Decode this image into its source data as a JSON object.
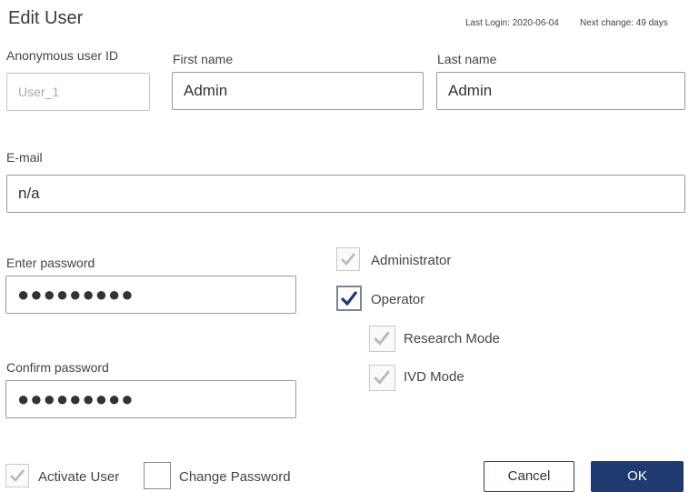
{
  "dialog": {
    "title": "Edit User",
    "last_login": "Last Login: 2020-06-04",
    "next_change": "Next change: 49 days"
  },
  "fields": {
    "anonymous_id": {
      "label": "Anonymous user ID",
      "placeholder": "User_1"
    },
    "first_name": {
      "label": "First name",
      "value": "Admin"
    },
    "last_name": {
      "label": "Last name",
      "value": "Admin"
    },
    "email": {
      "label": "E-mail",
      "value": "n/a"
    },
    "enter_password": {
      "label": "Enter password",
      "value": "●●●●●●●●●"
    },
    "confirm_password": {
      "label": "Confirm password",
      "value": "●●●●●●●●●"
    }
  },
  "roles": {
    "administrator": {
      "label": "Administrator",
      "checked": true,
      "disabled": true
    },
    "operator": {
      "label": "Operator",
      "checked": true,
      "disabled": false
    },
    "research_mode": {
      "label": "Research Mode",
      "checked": true,
      "disabled": true
    },
    "ivd_mode": {
      "label": "IVD Mode",
      "checked": true,
      "disabled": true
    }
  },
  "footer": {
    "activate_user": {
      "label": "Activate User",
      "checked": true,
      "disabled": true
    },
    "change_password": {
      "label": "Change Password",
      "checked": false
    },
    "cancel_label": "Cancel",
    "ok_label": "OK"
  },
  "icons": {
    "check": "check-icon"
  },
  "colors": {
    "ok_button": "#1e3a70",
    "cancel_border": "#2a3f6e",
    "check_active": "#1e3a70",
    "check_disabled": "#b9b9b9"
  }
}
